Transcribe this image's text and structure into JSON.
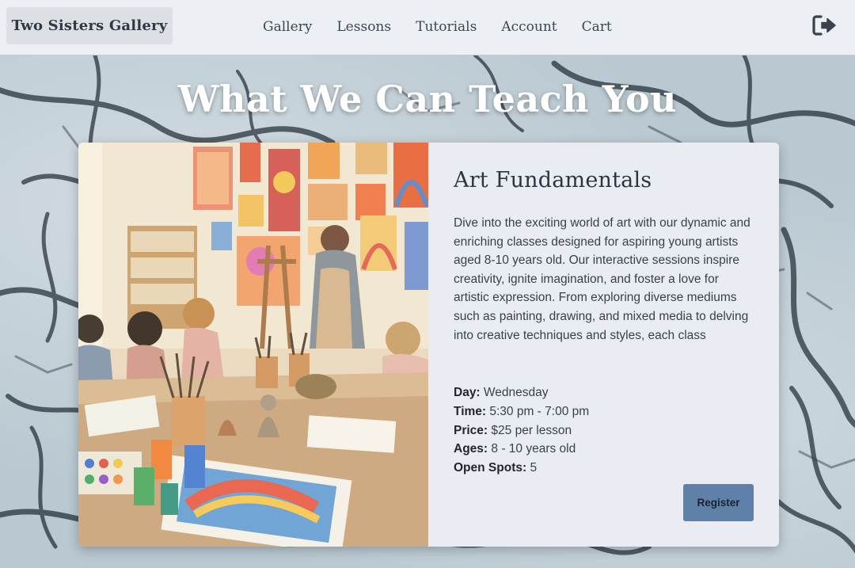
{
  "nav": {
    "brand": "Two Sisters Gallery",
    "links": [
      "Gallery",
      "Lessons",
      "Tutorials",
      "Account",
      "Cart"
    ],
    "logout_icon": "logout-icon"
  },
  "hero": {
    "title": "What We Can Teach You"
  },
  "course": {
    "title": "Art Fundamentals",
    "description": "Dive into the exciting world of art with our dynamic and enriching classes designed for aspiring young artists aged 8-10 years old. Our interactive sessions inspire creativity, ignite imagination, and foster a love for artistic expression. From exploring diverse mediums such as painting, drawing, and mixed media to delving into creative techniques and styles, each class",
    "details": {
      "day_label": "Day:",
      "day": "Wednesday",
      "time_label": "Time:",
      "time": "5:30 pm - 7:00 pm",
      "price_label": "Price:",
      "price": "$25 per lesson",
      "ages_label": "Ages:",
      "ages": "8 - 10 years old",
      "spots_label": "Open Spots:",
      "spots": "5"
    },
    "register_label": "Register"
  },
  "colors": {
    "nav_bg": "#eceff4",
    "card_bg": "#e9ecf2",
    "button": "#5e80a9",
    "title_text": "#2f3441"
  }
}
